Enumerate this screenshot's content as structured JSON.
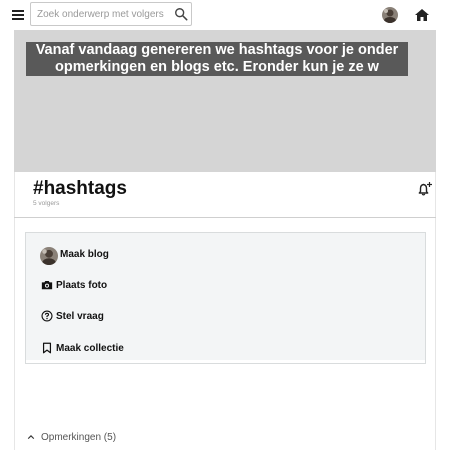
{
  "topbar": {
    "menu_icon": "hamburger-icon",
    "search": {
      "placeholder": "Zoek onderwerp met volgers",
      "value": "",
      "icon": "search-icon"
    },
    "avatar_icon": "user-avatar",
    "home_icon": "home-icon"
  },
  "banner": {
    "text": "Vanaf vandaag genereren we hashtags voor je onder opmerkingen en blogs etc. Eronder kun je ze w"
  },
  "topic": {
    "title": "#hashtags",
    "followers": "5 volgers",
    "bell_icon": "bell-plus-icon"
  },
  "actions": [
    {
      "label": "Maak blog",
      "icon": "avatar"
    },
    {
      "label": "Plaats foto",
      "icon": "camera-icon"
    },
    {
      "label": "Stel vraag",
      "icon": "question-circle-icon"
    },
    {
      "label": "Maak collectie",
      "icon": "bookmark-icon"
    }
  ],
  "comments": {
    "label": "Opmerkingen (5)",
    "icon": "chevron-up-icon"
  },
  "colors": {
    "banner_bg": "#d5d5d5",
    "banner_text_bg": "#595959",
    "card_bg": "#f3f5f6"
  }
}
